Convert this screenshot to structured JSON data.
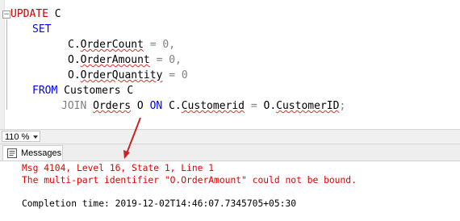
{
  "editor": {
    "line1_kw": "UPDATE",
    "line1_rest": " C",
    "line2_kw": "SET",
    "line3_a": "C.",
    "line3_b": "OrderCount",
    "line3_c": " = 0,",
    "line4_a": "O.",
    "line4_b": "OrderAmount",
    "line4_c": " = 0,",
    "line5_a": "O.",
    "line5_b": "OrderQuantity",
    "line5_c": " = 0",
    "line6_kw": "FROM",
    "line6_rest": " Customers C",
    "line7_join": "JOIN",
    "line7_orders": "Orders",
    "line7_o": " O ",
    "line7_on": "ON",
    "line7_c": " C.",
    "line7_custid": "Customerid",
    "line7_eq": " = ",
    "line7_o2": "O.",
    "line7_custid2": "CustomerID",
    "line7_end": ";"
  },
  "zoom": {
    "value": "110 %"
  },
  "results": {
    "tab_label": "Messages",
    "msg_line1": "Msg 4104, Level 16, State 1, Line 1",
    "msg_line2": "The multi-part identifier \"O.OrderAmount\" could not be bound.",
    "completion": "Completion time: 2019-12-02T14:46:07.7345705+05:30"
  },
  "colors": {
    "keyword": "#0000ff",
    "error": "#e00000",
    "squiggle": "#e03030",
    "arrow": "#cc2222"
  }
}
